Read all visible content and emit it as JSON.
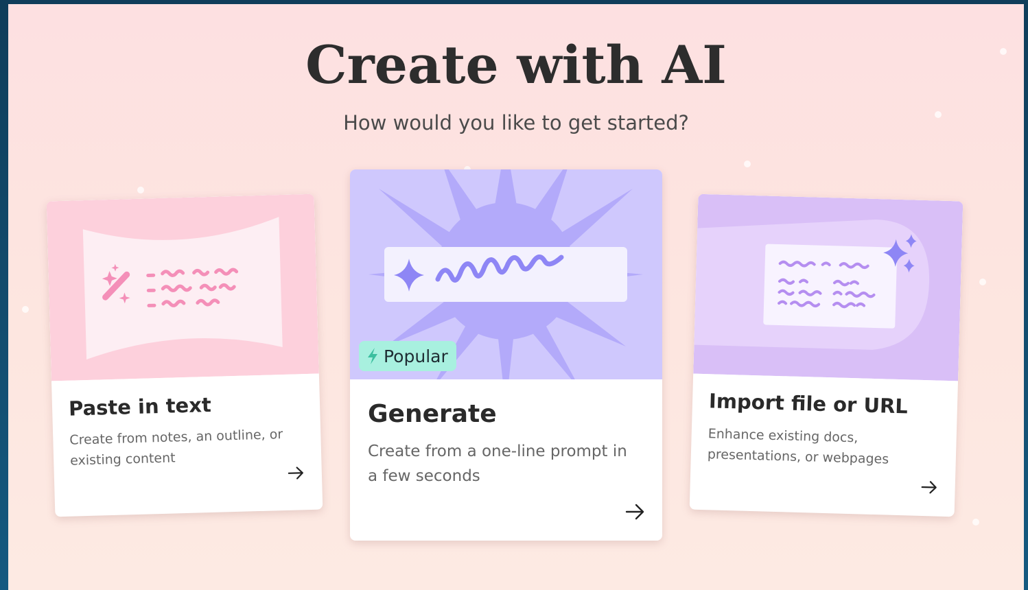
{
  "header": {
    "title": "Create with AI",
    "subtitle": "How would you like to get started?"
  },
  "cards": [
    {
      "title": "Paste in text",
      "description_line1": "Create from notes, an outline, or",
      "description_line2": "existing content",
      "icon": "magic-wand-icon",
      "accent": "#f48fb8"
    },
    {
      "title": "Generate",
      "description_line1": "Create from a one-line prompt in",
      "description_line2": "a few seconds",
      "badge": "Popular",
      "icon": "sparkle-icon",
      "accent": "#8e86f5"
    },
    {
      "title": "Import file or URL",
      "description_line1": "Enhance existing docs,",
      "description_line2": "presentations, or webpages",
      "icon": "sparkle-icon",
      "accent": "#b58ef0"
    }
  ],
  "colors": {
    "background_outer": "#155a80",
    "panel_bg": "#fde4e0",
    "badge_bg": "#a8f0df",
    "card1_illus_bg": "#fdd0dc",
    "card2_illus_bg": "#cfc8fd",
    "card3_illus_bg": "#d9bff7"
  }
}
